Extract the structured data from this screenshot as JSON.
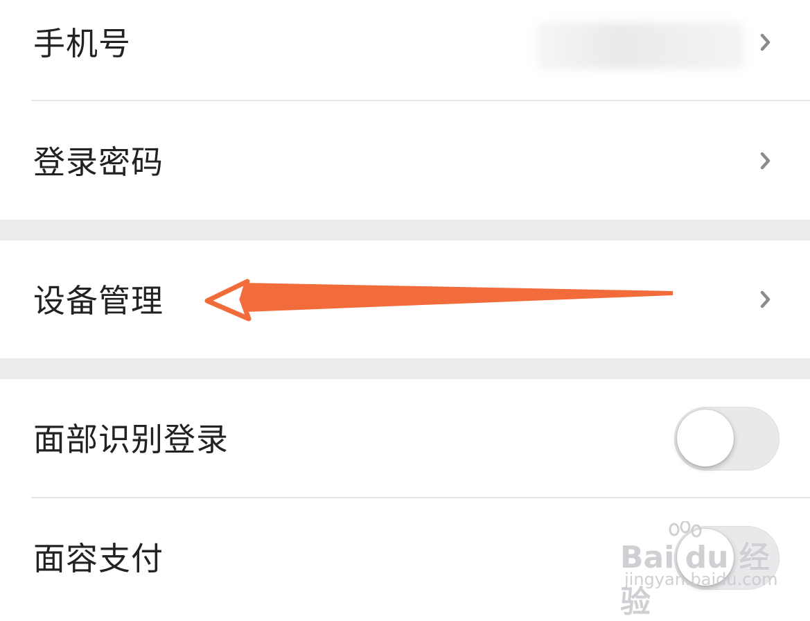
{
  "rows": {
    "phone": {
      "label": "手机号"
    },
    "login_password": {
      "label": "登录密码"
    },
    "device_management": {
      "label": "设备管理"
    },
    "face_login": {
      "label": "面部识别登录",
      "toggle_on": false
    },
    "face_pay": {
      "label": "面容支付",
      "toggle_on": false
    }
  },
  "annotation": {
    "arrow_color": "#F26B3A"
  },
  "watermark": {
    "main": "Bai du 经验",
    "sub": "jingyan.baidu.com"
  },
  "colors": {
    "background": "#FFFFFF",
    "section_gap": "#ECECEC",
    "divider": "#E5E5E5",
    "text": "#222222",
    "chevron": "#8A8A8F",
    "toggle_track_off": "#E9E9EC"
  }
}
